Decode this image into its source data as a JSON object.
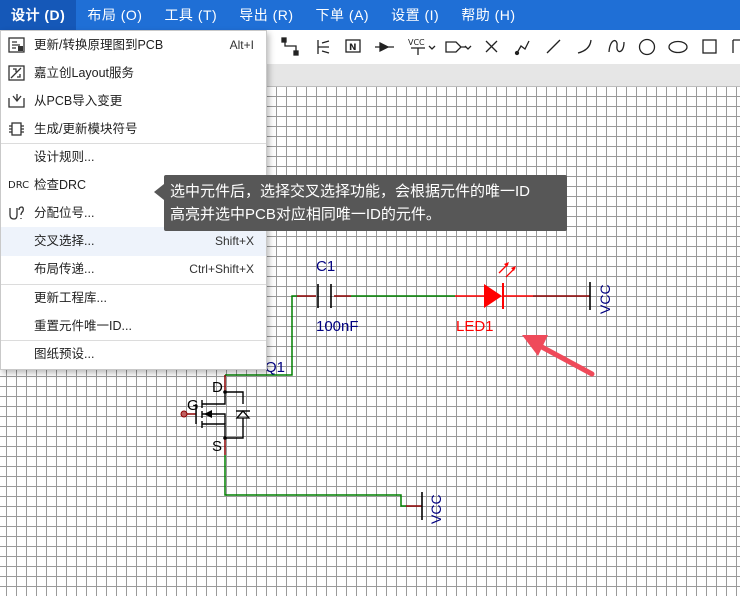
{
  "menubar": {
    "items": [
      {
        "label": "设计 (D)",
        "active": true
      },
      {
        "label": "布局 (O)"
      },
      {
        "label": "工具 (T)"
      },
      {
        "label": "导出 (R)"
      },
      {
        "label": "下单 (A)"
      },
      {
        "label": "设置 (I)"
      },
      {
        "label": "帮助 (H)"
      }
    ]
  },
  "toolbar": {
    "vcc_label": "VCC",
    "tools": [
      "wire-tool",
      "netlabel-tool",
      "netflag-tool",
      "netport-tool",
      "power-tool",
      "power-flag-tool",
      "no-connect-tool",
      "freehand-tool",
      "line-tool",
      "arc-tool",
      "bezier-tool",
      "circle-tool",
      "ellipse-tool",
      "rectangle-tool"
    ]
  },
  "design_menu": {
    "items": [
      {
        "label": "更新/转换原理图到PCB",
        "shortcut": "Alt+I",
        "icon": "convert-icon"
      },
      {
        "label": "嘉立创Layout服务",
        "shortcut": "",
        "icon": "layout-service-icon"
      },
      {
        "label": "从PCB导入变更",
        "shortcut": "",
        "icon": "import-icon"
      },
      {
        "label": "生成/更新模块符号",
        "shortcut": "",
        "icon": "module-symbol-icon"
      },
      {
        "label": "设计规则...",
        "shortcut": "",
        "icon": ""
      },
      {
        "label": "检查DRC",
        "shortcut": "",
        "icon": "drc-icon",
        "icon_text": "DRC"
      },
      {
        "label": "分配位号...",
        "shortcut": "",
        "icon": "designator-icon"
      },
      {
        "label": "交叉选择...",
        "shortcut": "Shift+X",
        "icon": ""
      },
      {
        "label": "布局传递...",
        "shortcut": "Ctrl+Shift+X",
        "icon": ""
      },
      {
        "label": "更新工程库...",
        "shortcut": "",
        "icon": ""
      },
      {
        "label": "重置元件唯一ID...",
        "shortcut": "",
        "icon": ""
      },
      {
        "label": "图纸预设...",
        "shortcut": "",
        "icon": ""
      }
    ]
  },
  "tooltip": {
    "line1": "选中元件后，选择交叉选择功能，会根据元件的唯一ID",
    "line2": "高亮并选中PCB对应相同唯一ID的元件。"
  },
  "schematic": {
    "capacitor_name": "C1",
    "capacitor_value": "100nF",
    "led_name": "LED1",
    "mosfet_name": "Q1",
    "pin_d": "D",
    "pin_g": "G",
    "pin_s": "S",
    "vcc_top": "VCC",
    "vcc_bottom": "VCC"
  },
  "colors": {
    "menubar": "#1f6fd6",
    "wire": "#008000",
    "pin": "#8b0000",
    "led": "#ff0000",
    "designator": "#000080",
    "annotation_arrow": "#ef4a5a"
  }
}
